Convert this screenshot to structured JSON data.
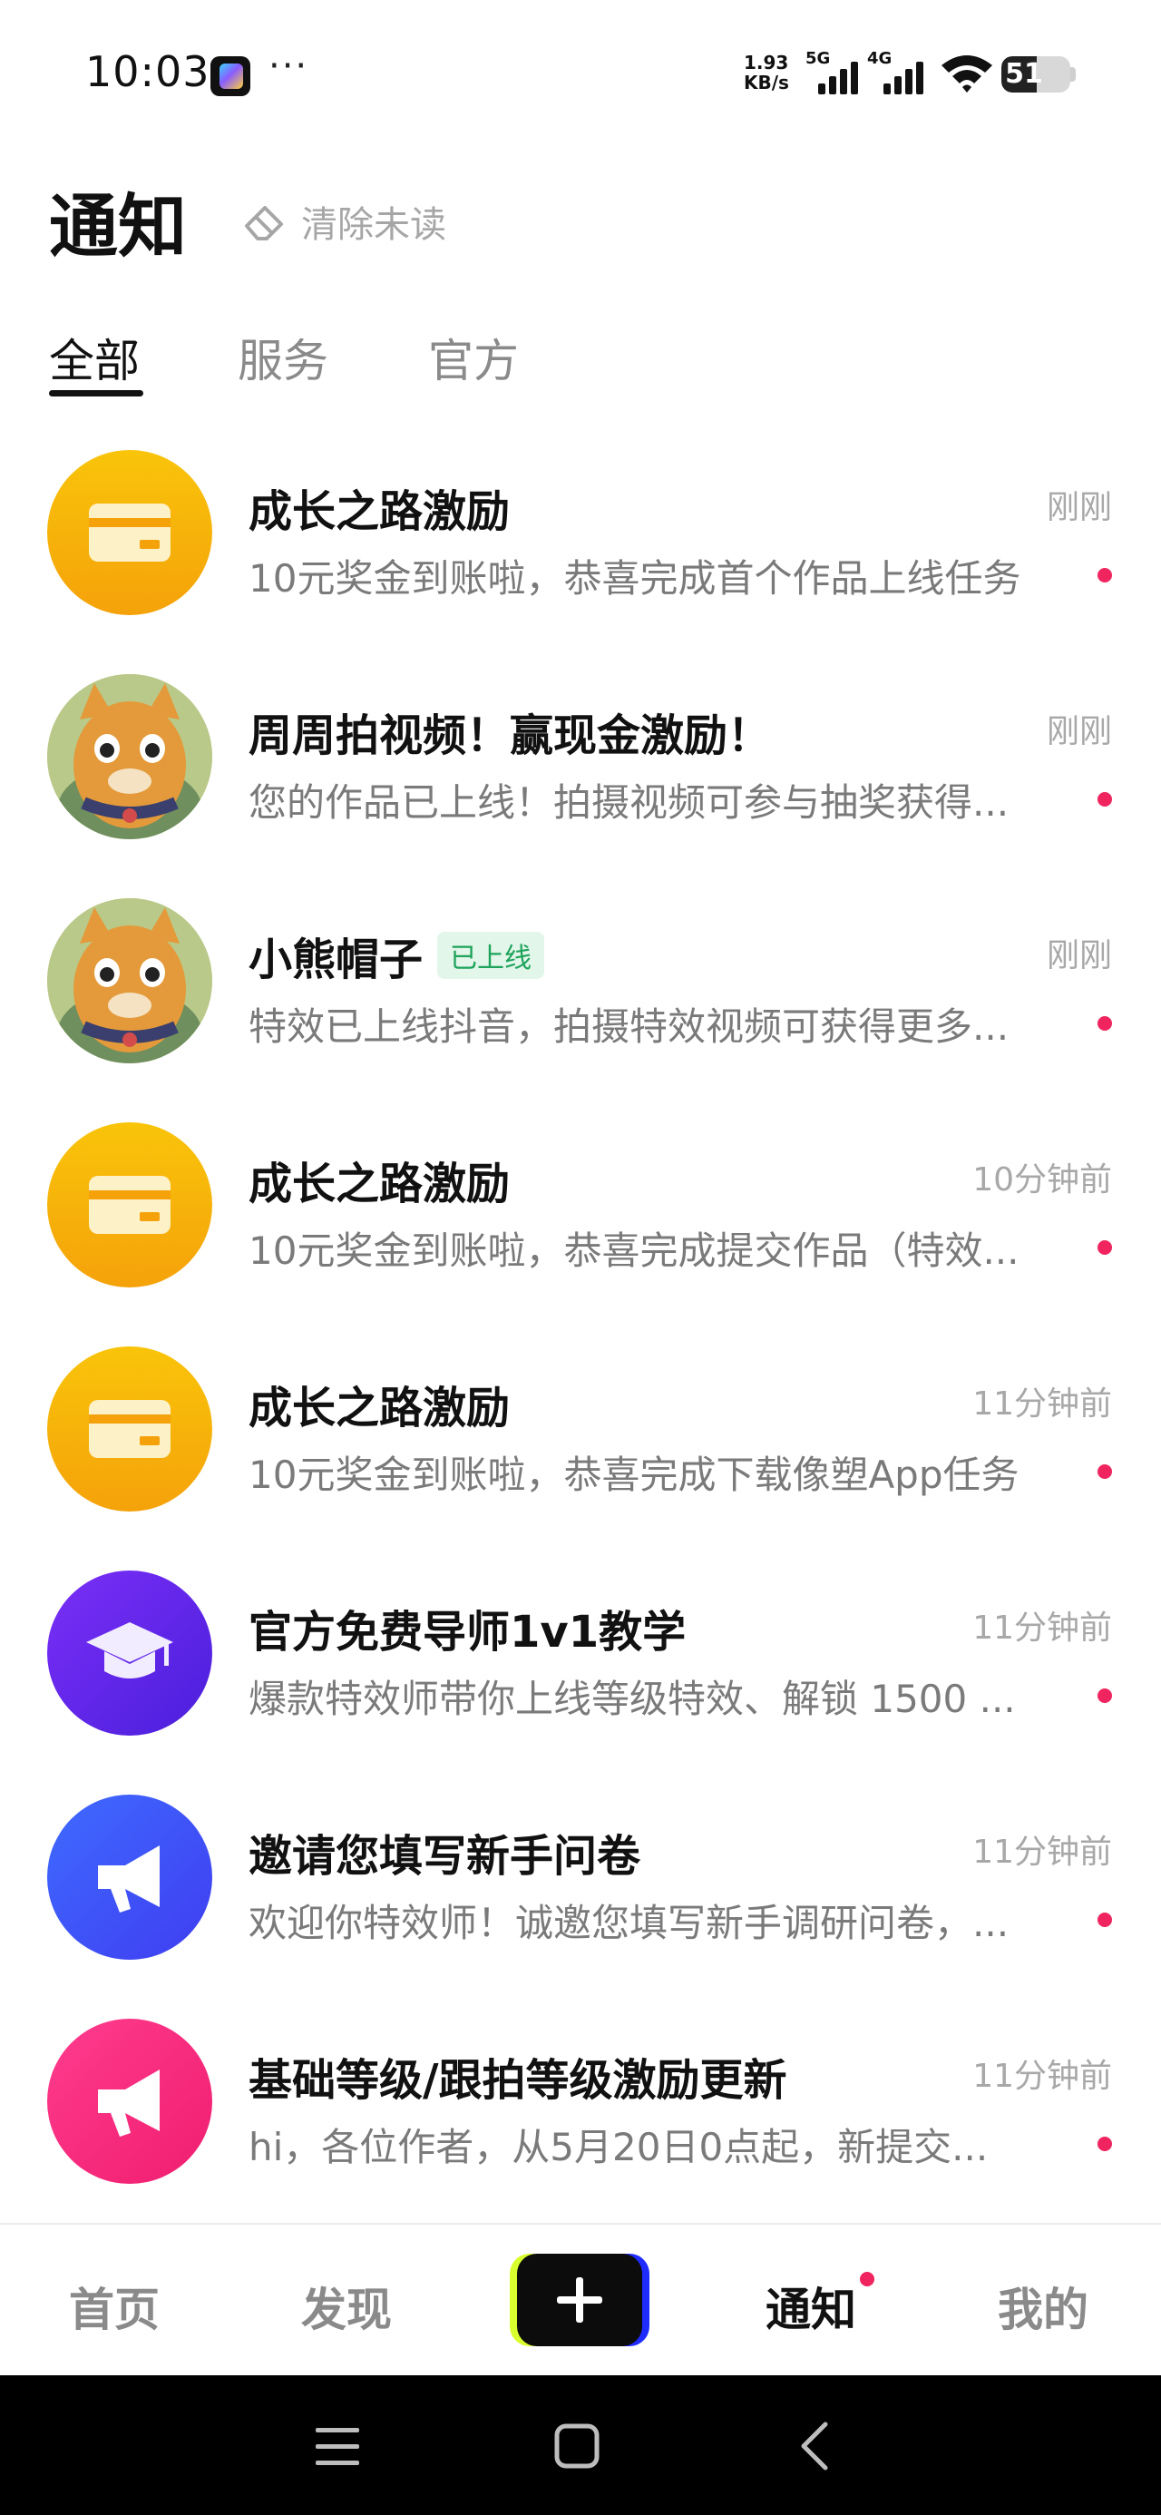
{
  "status_bar": {
    "time": "10:03",
    "more": "···",
    "net_speed_value": "1.93",
    "net_speed_unit": "KB/s",
    "sim1_label": "5G",
    "sim2_label": "4G",
    "battery": "51",
    "battery_level": 0.51
  },
  "header": {
    "title": "通知",
    "clear_unread": "清除未读"
  },
  "tabs": [
    {
      "label": "全部",
      "active": true
    },
    {
      "label": "服务",
      "active": false
    },
    {
      "label": "官方",
      "active": false
    }
  ],
  "notifications": [
    {
      "avatar": "card-icon",
      "title": "成长之路激励",
      "time": "刚刚",
      "desc": "10元奖金到账啦，恭喜完成首个作品上线任务",
      "unread": true
    },
    {
      "avatar": "cat-avatar",
      "title": "周周拍视频！赢现金激励！",
      "time": "刚刚",
      "desc": "您的作品已上线！拍摄视频可参与抽奖获得...",
      "unread": true
    },
    {
      "avatar": "cat-avatar",
      "title": "小熊帽子",
      "tag": "已上线",
      "time": "刚刚",
      "desc": "特效已上线抖音，拍摄特效视频可获得更多...",
      "unread": true
    },
    {
      "avatar": "card-icon",
      "title": "成长之路激励",
      "time": "10分钟前",
      "desc": "10元奖金到账啦，恭喜完成提交作品（特效...",
      "unread": true
    },
    {
      "avatar": "card-icon",
      "title": "成长之路激励",
      "time": "11分钟前",
      "desc": "10元奖金到账啦，恭喜完成下载像塑App任务",
      "unread": true
    },
    {
      "avatar": "graduation-cap-icon",
      "title": "官方免费导师1v1教学",
      "time": "11分钟前",
      "desc": "爆款特效师带你上线等级特效、解锁 1500 ...",
      "unread": true
    },
    {
      "avatar": "megaphone-icon",
      "title": "邀请您填写新手问卷",
      "time": "11分钟前",
      "desc": "欢迎你特效师！诚邀您填写新手调研问卷，...",
      "unread": true
    },
    {
      "avatar": "megaphone-icon",
      "title": "基础等级/跟拍等级激励更新",
      "time": "11分钟前",
      "desc": "hi，各位作者，从5月20日0点起，新提交...",
      "unread": true
    }
  ],
  "bottom_nav": {
    "home": "首页",
    "discover": "发现",
    "notifications": "通知",
    "me": "我的",
    "active": "notifications"
  }
}
